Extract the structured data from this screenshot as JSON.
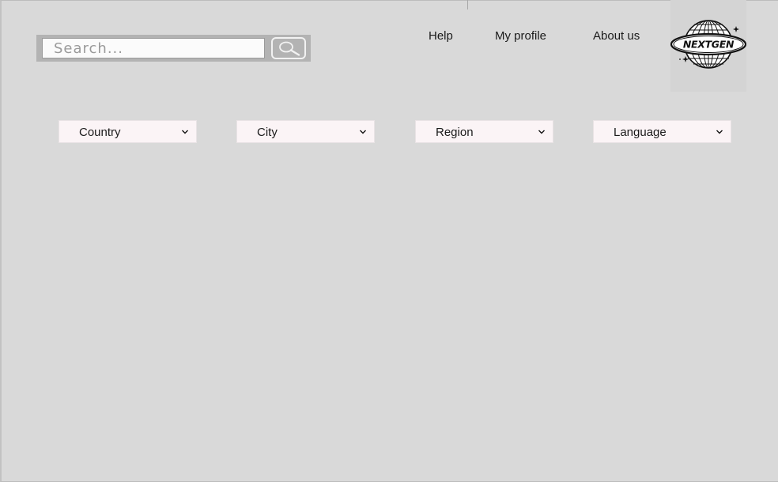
{
  "search": {
    "placeholder": "Search...",
    "button_icon": "magnifier-icon"
  },
  "nav": {
    "items": [
      {
        "label": "Help"
      },
      {
        "label": "My profile"
      },
      {
        "label": "About us"
      }
    ]
  },
  "logo": {
    "text": "NEXTGEN",
    "icon": "globe-logo-icon"
  },
  "filters": [
    {
      "label": "Country",
      "icon": "chevron-down-icon"
    },
    {
      "label": "City",
      "icon": "chevron-down-icon"
    },
    {
      "label": "Region",
      "icon": "chevron-down-icon"
    },
    {
      "label": "Language",
      "icon": "chevron-down-icon"
    }
  ],
  "colors": {
    "background": "#d9d9d9",
    "search_frame": "#b3b3b3",
    "dropdown_bg": "#fbf4f6",
    "text": "#1a1a1a"
  }
}
